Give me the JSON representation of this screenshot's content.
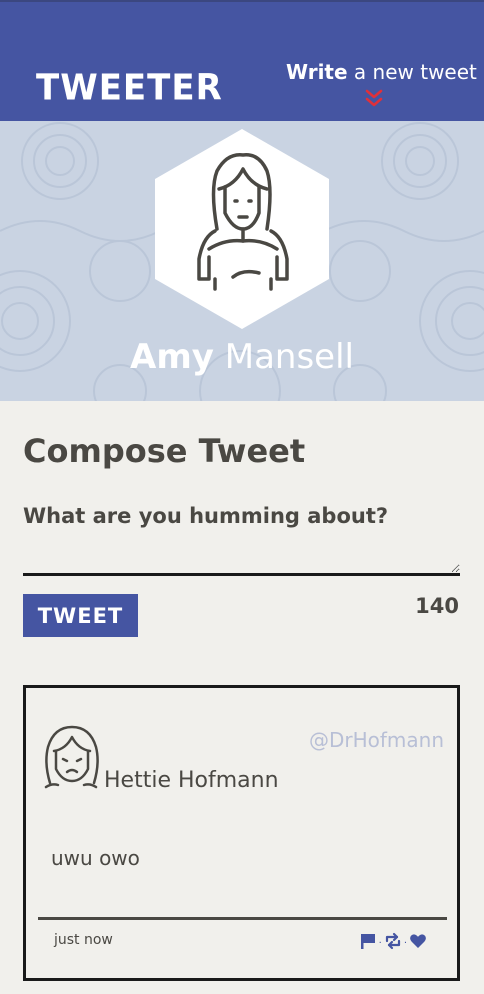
{
  "header": {
    "logo": "TWEETER",
    "write_strong": "Write",
    "write_rest": " a new tweet",
    "chevron_icon": "double-chevron-down-icon",
    "chevron_color": "#e0303a",
    "background": "#4555a2"
  },
  "profile": {
    "first_name": "Amy",
    "last_name": " Mansell",
    "avatar_icon": "woman-avatar-icon"
  },
  "compose": {
    "title": "Compose Tweet",
    "label": "What are you humming about?",
    "textarea_value": "",
    "button_label": "TWEET",
    "char_count": "140"
  },
  "tweet": {
    "author": "Hettie Hofmann",
    "handle": "@DrHofmann",
    "text": "uwu owo",
    "time": "just now",
    "avatar_icon": "woman-avatar-icon",
    "actions": [
      "flag-icon",
      "retweet-icon",
      "heart-icon"
    ]
  }
}
